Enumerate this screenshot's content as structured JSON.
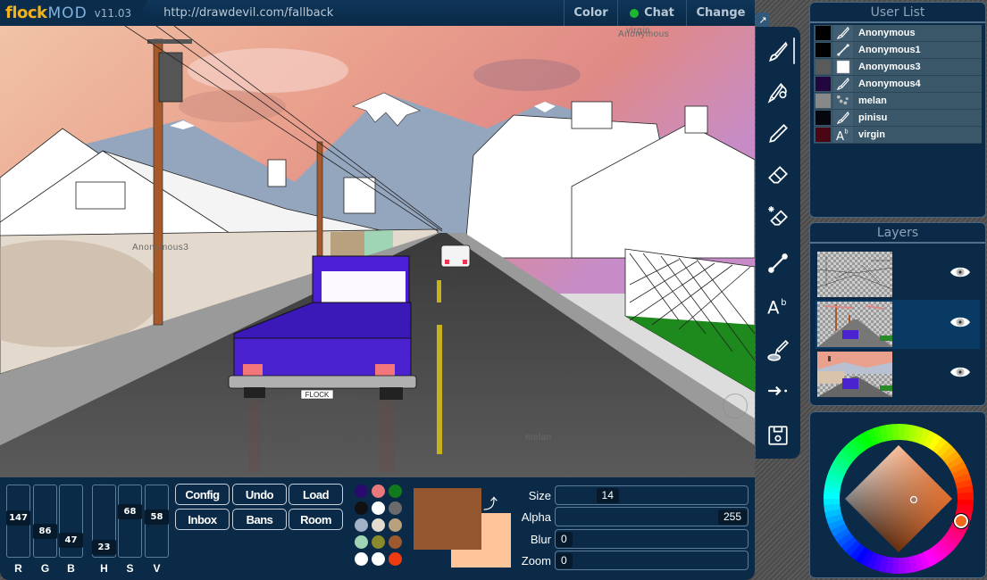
{
  "app": {
    "logo_part1": "flock",
    "logo_part2": "MOD",
    "version": "v11.03",
    "url": "http://drawdevil.com/fallback"
  },
  "topbar": {
    "color_label": "Color",
    "chat_label": "Chat",
    "chat_status_color": "#1fb52f",
    "change_label": "Change"
  },
  "canvas": {
    "cursors": [
      {
        "name": "Anonymous"
      },
      {
        "name": "virgin"
      },
      {
        "name": "Anonymous3"
      },
      {
        "name": "melan"
      }
    ],
    "license_plate": "FLOCK"
  },
  "tools": [
    {
      "name": "brush-icon",
      "active": true
    },
    {
      "name": "multi-brush-icon"
    },
    {
      "name": "pencil-icon"
    },
    {
      "name": "eraser-icon"
    },
    {
      "name": "magic-eraser-icon"
    },
    {
      "name": "line-icon"
    },
    {
      "name": "text-icon"
    },
    {
      "name": "eyedropper-icon"
    },
    {
      "name": "pan-icon"
    },
    {
      "name": "save-icon"
    }
  ],
  "color_sliders": [
    {
      "label": "R",
      "value": "147",
      "fraction": 0.576
    },
    {
      "label": "G",
      "value": "86",
      "fraction": 0.337
    },
    {
      "label": "B",
      "value": "47",
      "fraction": 0.184
    },
    {
      "label": "H",
      "value": "23",
      "fraction": 0.064
    },
    {
      "label": "S",
      "value": "68",
      "fraction": 0.68
    },
    {
      "label": "V",
      "value": "58",
      "fraction": 0.58
    }
  ],
  "buttons": {
    "config": "Config",
    "undo": "Undo",
    "load": "Load",
    "inbox": "Inbox",
    "bans": "Bans",
    "room": "Room"
  },
  "palette": [
    "#2b0a6e",
    "#e8787a",
    "#117a1a",
    "#111111",
    "#ffffff",
    "#6b6b6b",
    "#a2b0c8",
    "#e4dbd0",
    "#b9a07e",
    "#9fd5b5",
    "#8a8a2c",
    "#9e5a2e",
    "#ffffff",
    "#ffffff",
    "#f03a12"
  ],
  "colors": {
    "primary": "#93562f",
    "secondary": "#ffc59a"
  },
  "brush_props": [
    {
      "label": "Size",
      "value": "14",
      "fraction": 0.27
    },
    {
      "label": "Alpha",
      "value": "255",
      "fraction": 1.0
    },
    {
      "label": "Blur",
      "value": "0",
      "fraction": 0
    },
    {
      "label": "Zoom",
      "value": "0",
      "fraction": 0
    }
  ],
  "user_list": {
    "title": "User List",
    "users": [
      {
        "name": "Anonymous",
        "color": "#000000",
        "tool": "brush-icon"
      },
      {
        "name": "Anonymous1",
        "color": "#000000",
        "tool": "line-icon"
      },
      {
        "name": "Anonymous3",
        "color": "#5a5a5a",
        "tool": "square-icon"
      },
      {
        "name": "Anonymous4",
        "color": "#24063f",
        "tool": "brush-icon"
      },
      {
        "name": "melan",
        "color": "#888888",
        "tool": "spray-icon"
      },
      {
        "name": "pinisu",
        "color": "#06060f",
        "tool": "brush-icon"
      },
      {
        "name": "virgin",
        "color": "#4a0612",
        "tool": "text-icon"
      }
    ]
  },
  "layers": {
    "title": "Layers",
    "items": [
      {
        "name": "layer-1",
        "visible": true,
        "active": false
      },
      {
        "name": "layer-2",
        "visible": true,
        "active": true
      },
      {
        "name": "layer-3",
        "visible": true,
        "active": false
      }
    ]
  },
  "color_wheel": {
    "hue_degrees": 23,
    "selected_color": "#f26a1b"
  }
}
